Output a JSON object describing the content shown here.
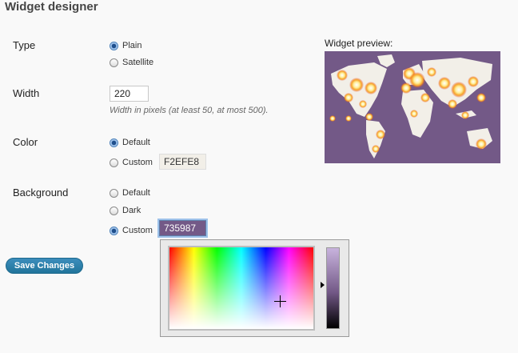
{
  "page": {
    "title": "Widget designer"
  },
  "type": {
    "label": "Type",
    "options": [
      {
        "label": "Plain",
        "checked": true
      },
      {
        "label": "Satellite",
        "checked": false
      }
    ]
  },
  "width": {
    "label": "Width",
    "value": "220",
    "hint": "Width in pixels (at least 50, at most 500)."
  },
  "color": {
    "label": "Color",
    "options": [
      {
        "label": "Default",
        "checked": true
      },
      {
        "label": "Custom",
        "checked": false
      }
    ],
    "custom_value": "F2EFE8"
  },
  "background": {
    "label": "Background",
    "options": [
      {
        "label": "Default",
        "checked": false
      },
      {
        "label": "Dark",
        "checked": false
      },
      {
        "label": "Custom",
        "checked": true
      }
    ],
    "custom_value": "735987"
  },
  "preview": {
    "label": "Widget preview:",
    "map_bg": "#735987",
    "land": "#f2efe8"
  },
  "actions": {
    "save_label": "Save Changes"
  },
  "picker": {
    "hue_color": "#735987"
  }
}
